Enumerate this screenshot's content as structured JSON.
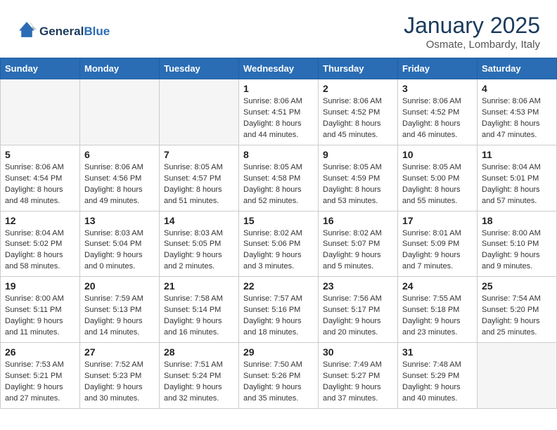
{
  "header": {
    "logo_line1": "General",
    "logo_line2": "Blue",
    "month": "January 2025",
    "location": "Osmate, Lombardy, Italy"
  },
  "days_of_week": [
    "Sunday",
    "Monday",
    "Tuesday",
    "Wednesday",
    "Thursday",
    "Friday",
    "Saturday"
  ],
  "weeks": [
    [
      {
        "day": "",
        "info": ""
      },
      {
        "day": "",
        "info": ""
      },
      {
        "day": "",
        "info": ""
      },
      {
        "day": "1",
        "info": "Sunrise: 8:06 AM\nSunset: 4:51 PM\nDaylight: 8 hours\nand 44 minutes."
      },
      {
        "day": "2",
        "info": "Sunrise: 8:06 AM\nSunset: 4:52 PM\nDaylight: 8 hours\nand 45 minutes."
      },
      {
        "day": "3",
        "info": "Sunrise: 8:06 AM\nSunset: 4:52 PM\nDaylight: 8 hours\nand 46 minutes."
      },
      {
        "day": "4",
        "info": "Sunrise: 8:06 AM\nSunset: 4:53 PM\nDaylight: 8 hours\nand 47 minutes."
      }
    ],
    [
      {
        "day": "5",
        "info": "Sunrise: 8:06 AM\nSunset: 4:54 PM\nDaylight: 8 hours\nand 48 minutes."
      },
      {
        "day": "6",
        "info": "Sunrise: 8:06 AM\nSunset: 4:56 PM\nDaylight: 8 hours\nand 49 minutes."
      },
      {
        "day": "7",
        "info": "Sunrise: 8:05 AM\nSunset: 4:57 PM\nDaylight: 8 hours\nand 51 minutes."
      },
      {
        "day": "8",
        "info": "Sunrise: 8:05 AM\nSunset: 4:58 PM\nDaylight: 8 hours\nand 52 minutes."
      },
      {
        "day": "9",
        "info": "Sunrise: 8:05 AM\nSunset: 4:59 PM\nDaylight: 8 hours\nand 53 minutes."
      },
      {
        "day": "10",
        "info": "Sunrise: 8:05 AM\nSunset: 5:00 PM\nDaylight: 8 hours\nand 55 minutes."
      },
      {
        "day": "11",
        "info": "Sunrise: 8:04 AM\nSunset: 5:01 PM\nDaylight: 8 hours\nand 57 minutes."
      }
    ],
    [
      {
        "day": "12",
        "info": "Sunrise: 8:04 AM\nSunset: 5:02 PM\nDaylight: 8 hours\nand 58 minutes."
      },
      {
        "day": "13",
        "info": "Sunrise: 8:03 AM\nSunset: 5:04 PM\nDaylight: 9 hours\nand 0 minutes."
      },
      {
        "day": "14",
        "info": "Sunrise: 8:03 AM\nSunset: 5:05 PM\nDaylight: 9 hours\nand 2 minutes."
      },
      {
        "day": "15",
        "info": "Sunrise: 8:02 AM\nSunset: 5:06 PM\nDaylight: 9 hours\nand 3 minutes."
      },
      {
        "day": "16",
        "info": "Sunrise: 8:02 AM\nSunset: 5:07 PM\nDaylight: 9 hours\nand 5 minutes."
      },
      {
        "day": "17",
        "info": "Sunrise: 8:01 AM\nSunset: 5:09 PM\nDaylight: 9 hours\nand 7 minutes."
      },
      {
        "day": "18",
        "info": "Sunrise: 8:00 AM\nSunset: 5:10 PM\nDaylight: 9 hours\nand 9 minutes."
      }
    ],
    [
      {
        "day": "19",
        "info": "Sunrise: 8:00 AM\nSunset: 5:11 PM\nDaylight: 9 hours\nand 11 minutes."
      },
      {
        "day": "20",
        "info": "Sunrise: 7:59 AM\nSunset: 5:13 PM\nDaylight: 9 hours\nand 14 minutes."
      },
      {
        "day": "21",
        "info": "Sunrise: 7:58 AM\nSunset: 5:14 PM\nDaylight: 9 hours\nand 16 minutes."
      },
      {
        "day": "22",
        "info": "Sunrise: 7:57 AM\nSunset: 5:16 PM\nDaylight: 9 hours\nand 18 minutes."
      },
      {
        "day": "23",
        "info": "Sunrise: 7:56 AM\nSunset: 5:17 PM\nDaylight: 9 hours\nand 20 minutes."
      },
      {
        "day": "24",
        "info": "Sunrise: 7:55 AM\nSunset: 5:18 PM\nDaylight: 9 hours\nand 23 minutes."
      },
      {
        "day": "25",
        "info": "Sunrise: 7:54 AM\nSunset: 5:20 PM\nDaylight: 9 hours\nand 25 minutes."
      }
    ],
    [
      {
        "day": "26",
        "info": "Sunrise: 7:53 AM\nSunset: 5:21 PM\nDaylight: 9 hours\nand 27 minutes."
      },
      {
        "day": "27",
        "info": "Sunrise: 7:52 AM\nSunset: 5:23 PM\nDaylight: 9 hours\nand 30 minutes."
      },
      {
        "day": "28",
        "info": "Sunrise: 7:51 AM\nSunset: 5:24 PM\nDaylight: 9 hours\nand 32 minutes."
      },
      {
        "day": "29",
        "info": "Sunrise: 7:50 AM\nSunset: 5:26 PM\nDaylight: 9 hours\nand 35 minutes."
      },
      {
        "day": "30",
        "info": "Sunrise: 7:49 AM\nSunset: 5:27 PM\nDaylight: 9 hours\nand 37 minutes."
      },
      {
        "day": "31",
        "info": "Sunrise: 7:48 AM\nSunset: 5:29 PM\nDaylight: 9 hours\nand 40 minutes."
      },
      {
        "day": "",
        "info": ""
      }
    ]
  ]
}
